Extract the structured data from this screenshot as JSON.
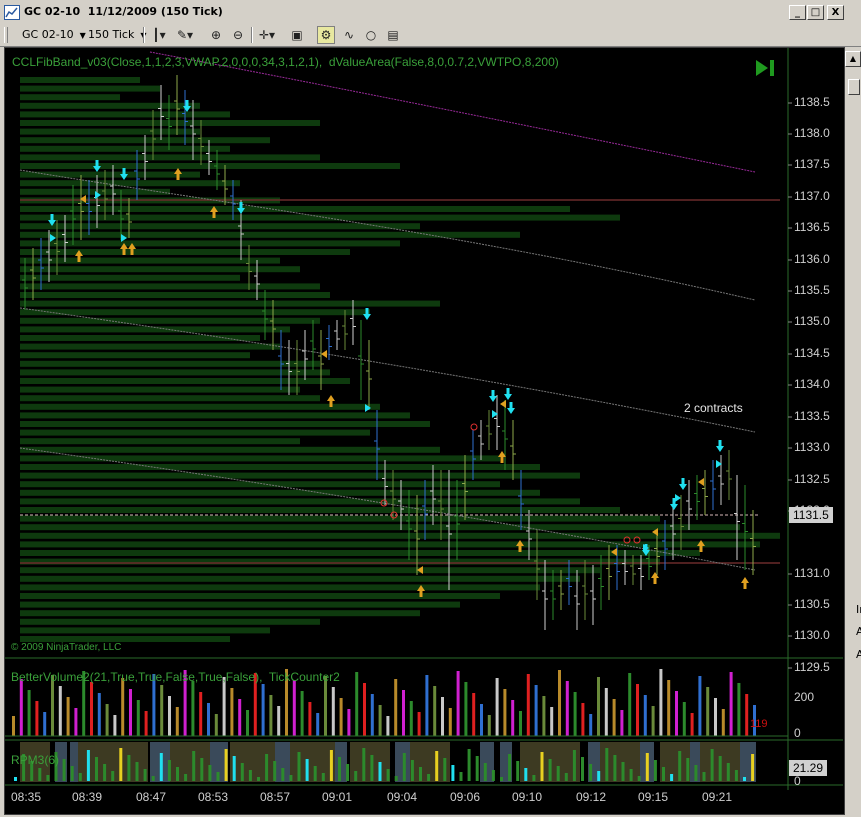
{
  "window": {
    "title": "GC 02-10  11/12/2009 (150 Tick)",
    "buttons": [
      "_",
      "□",
      "X"
    ]
  },
  "toolbar": {
    "instrument": "GC 02-10",
    "interval": "150 Tick"
  },
  "panels": {
    "price": {
      "indicator_label": "CCLFibBand_v03(Close,1,1,2,3,VWAP,2,0,0,0,34,3,1,2,1),  dValueArea(False,8,0,0.7,2,VWTPO,8,200)",
      "copyright": "© 2009 NinjaTrader, LLC",
      "annotation": "2 contracts",
      "last_price": "1131.5",
      "y_ticks": [
        "1138.5",
        "1138.0",
        "1137.5",
        "1137.0",
        "1136.5",
        "1136.0",
        "1135.5",
        "1135.0",
        "1134.5",
        "1134.0",
        "1133.5",
        "1133.0",
        "1132.5",
        "1132.0",
        "1131.0",
        "1130.5",
        "1130.0",
        "1129.5"
      ]
    },
    "volume": {
      "indicator_label": "BetterVolume2(21,True,True,False,True,False),  TickCounter2",
      "y_ticks": [
        "200",
        "0"
      ],
      "tick_counter": "119"
    },
    "rpm": {
      "indicator_label": "RPM3(6)",
      "last_value": "21.29",
      "y_ticks": [
        "0"
      ]
    }
  },
  "x_ticks": [
    "08:35",
    "08:39",
    "08:47",
    "08:53",
    "08:57",
    "09:01",
    "09:04",
    "09:06",
    "09:10",
    "09:12",
    "09:15",
    "09:21"
  ],
  "scrollbar": {
    "side_labels": [
      "In",
      "A",
      "A"
    ]
  },
  "colors": {
    "background": "#000000",
    "label_green": "#3aa03a",
    "value_area": "#0e3a0e",
    "arrow_up": "#e0a020",
    "arrow_down": "#20e0f0",
    "last_price_tag": "#d0d0d0",
    "rpm_tag": "#d0d0d0"
  }
}
